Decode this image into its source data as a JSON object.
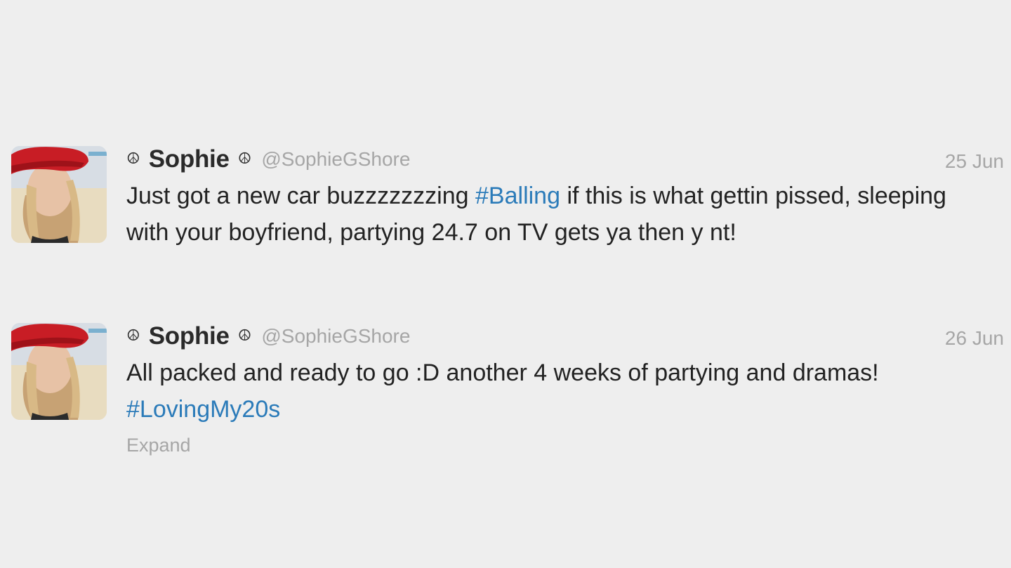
{
  "tweets": [
    {
      "name": "Sophie",
      "name_prefix_icon": "☮",
      "name_suffix_icon": "☮",
      "handle": "@SophieGShore",
      "date": "25 Jun",
      "text_parts": [
        "Just got a new car buzzzzzzzing ",
        "#Balling",
        " if this is what gettin pissed, sleeping with your boyfriend, partying 24.7 on TV gets ya then y nt!"
      ]
    },
    {
      "name": "Sophie",
      "name_prefix_icon": "☮",
      "name_suffix_icon": "☮",
      "handle": "@SophieGShore",
      "date": "26 Jun",
      "text_parts": [
        "All packed and ready to go :D another 4 weeks of partying and dramas! ",
        "#LovingMy20s"
      ],
      "expand_label": "Expand"
    }
  ],
  "colors": {
    "background": "#eeeeee",
    "hashtag": "#2b7bb9",
    "muted": "#a6a6a6",
    "text": "#222222"
  }
}
